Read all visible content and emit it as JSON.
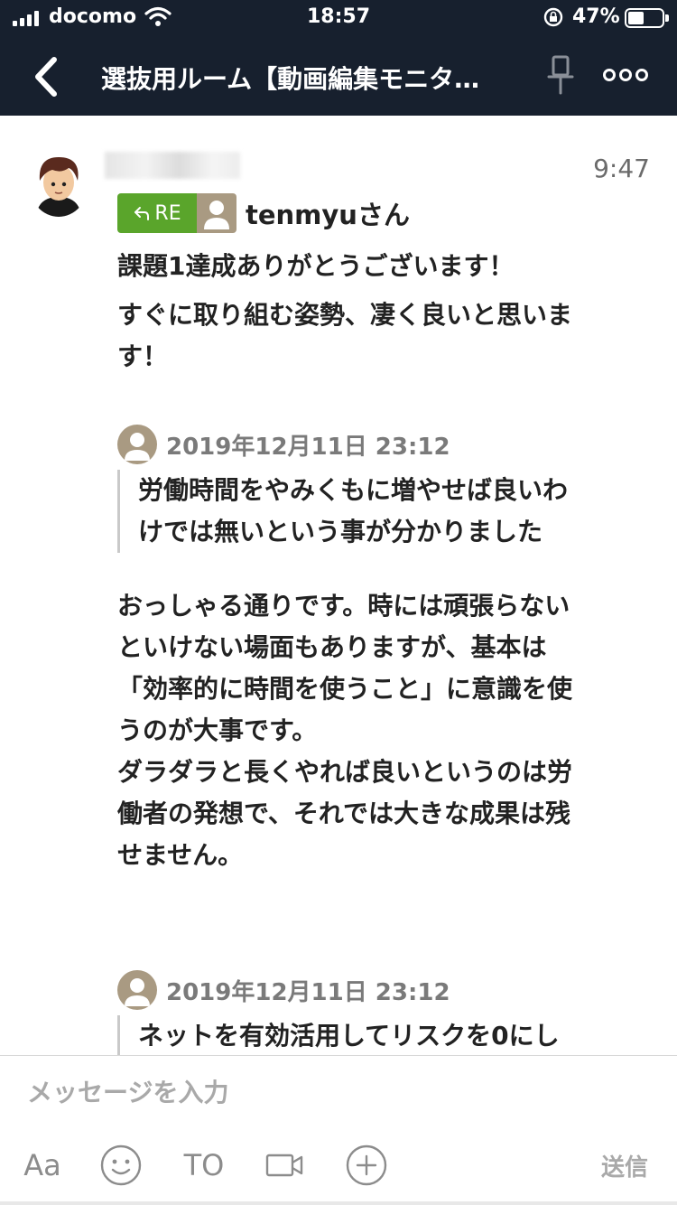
{
  "status_bar": {
    "carrier": "docomo",
    "time": "18:57",
    "battery_percent": "47%",
    "battery_level": 0.47
  },
  "header": {
    "title": "選抜用ルーム【動画編集モニタ…",
    "back_icon": "chevron-left-icon",
    "pin_icon": "pin-icon",
    "more_icon": "more-icon"
  },
  "message": {
    "time": "9:47",
    "reply_badge": "RE",
    "reply_to": "tenmyuさん",
    "paragraph1": [
      "課題1達成ありがとうございます！",
      "すぐに取り組む姿勢、凄く良いと思いま",
      "す！"
    ],
    "quote1": {
      "date": "2019年12月11日 23:12",
      "lines": [
        "労働時間をやみくもに増やせば良いわ",
        "けでは無いという事が分かりました"
      ]
    },
    "paragraph2": [
      "おっしゃる通りです。時には頑張らない",
      "といけない場面もありますが、基本は",
      "「効率的に時間を使うこと」に意識を使",
      "うのが大事です。",
      "ダラダラと長くやれば良いというのは労",
      "働者の発想で、それでは大きな成果は残",
      "せません。"
    ],
    "quote2": {
      "date": "2019年12月11日 23:12",
      "lines": [
        "ネットを有効活用してリスクを0にし"
      ]
    }
  },
  "composer": {
    "placeholder": "メッセージを入力",
    "text_style_label": "Aa",
    "to_label": "TO",
    "send_label": "送信"
  },
  "colors": {
    "header_bg": "#17202e",
    "re_badge": "#5aa52b",
    "default_avatar": "#a99a82"
  }
}
